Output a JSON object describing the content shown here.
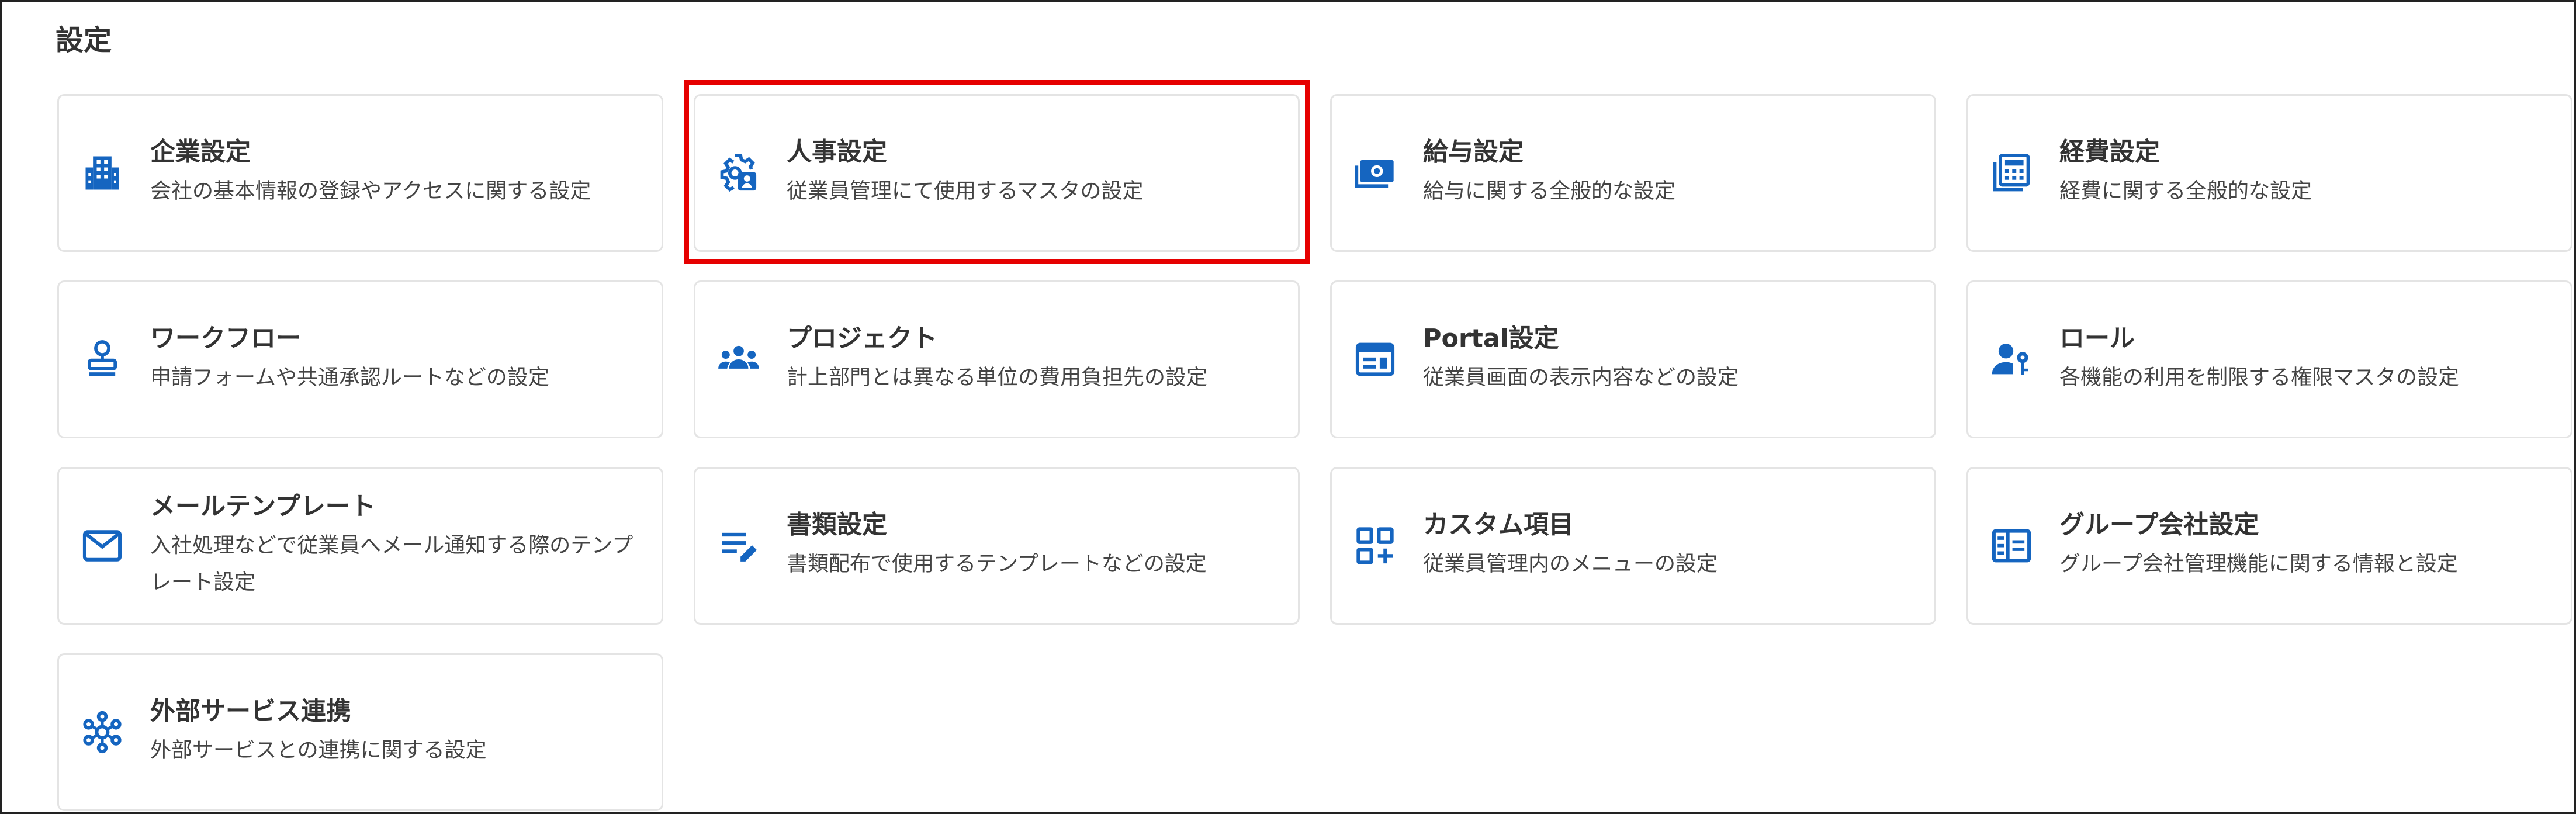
{
  "page": {
    "title": "設定"
  },
  "accent_color": "#1565c0",
  "highlight_color": "#e60000",
  "cards": [
    {
      "icon": "building-icon",
      "title": "企業設定",
      "description": "会社の基本情報の登録やアクセスに関する設定"
    },
    {
      "icon": "gear-person-icon",
      "title": "人事設定",
      "description": "従業員管理にて使用するマスタの設定",
      "highlighted": true
    },
    {
      "icon": "money-icon",
      "title": "給与設定",
      "description": "給与に関する全般的な設定"
    },
    {
      "icon": "calculator-icon",
      "title": "経費設定",
      "description": "経費に関する全般的な設定"
    },
    {
      "icon": "stamp-icon",
      "title": "ワークフロー",
      "description": "申請フォームや共通承認ルートなどの設定"
    },
    {
      "icon": "group-icon",
      "title": "プロジェクト",
      "description": "計上部門とは異なる単位の費用負担先の設定"
    },
    {
      "icon": "portal-icon",
      "title": "Portal設定",
      "description": "従業員画面の表示内容などの設定"
    },
    {
      "icon": "person-key-icon",
      "title": "ロール",
      "description": "各機能の利用を制限する権限マスタの設定"
    },
    {
      "icon": "mail-icon",
      "title": "メールテンプレート",
      "description": "入社処理などで従業員へメール通知する際のテンプレート設定"
    },
    {
      "icon": "document-edit-icon",
      "title": "書類設定",
      "description": "書類配布で使用するテンプレートなどの設定"
    },
    {
      "icon": "custom-grid-icon",
      "title": "カスタム項目",
      "description": "従業員管理内のメニューの設定"
    },
    {
      "icon": "group-company-icon",
      "title": "グループ会社設定",
      "description": "グループ会社管理機能に関する情報と設定"
    },
    {
      "icon": "network-icon",
      "title": "外部サービス連携",
      "description": "外部サービスとの連携に関する設定"
    }
  ]
}
